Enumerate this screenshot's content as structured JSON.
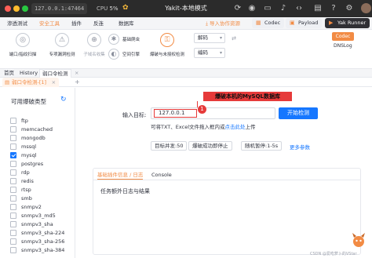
{
  "titlebar": {
    "ip": "127.0.0.1:47464",
    "cpu_label": "CPU",
    "cpu_value": "5%",
    "title": "Yakit-本地模式"
  },
  "menu": {
    "items": [
      "渗透测试",
      "安全工具",
      "插件",
      "反连",
      "数据库"
    ],
    "active": "安全工具",
    "import_label": "导入协作资源",
    "codec_btn": "Codec",
    "payload_btn": "Payload",
    "yakrunner_btn": "Yak Runner"
  },
  "toolbar": {
    "tools": [
      {
        "label": "端口/指纹扫描",
        "state": "normal",
        "icon": "port-scan-icon"
      },
      {
        "label": "专项漏洞检测",
        "state": "normal",
        "icon": "vuln-scan-icon"
      },
      {
        "label": "子域名收集",
        "state": "faded",
        "icon": "subdomain-icon"
      }
    ],
    "tools_h": [
      {
        "label": "基础爬虫",
        "icon": "crawler-icon"
      },
      {
        "label": "空间引擎",
        "icon": "space-engine-icon"
      }
    ],
    "brute_label": "爆破与未授权检测",
    "decode_select": "解码",
    "encode_select": "编码",
    "codec_badge": "Codec",
    "dnslog": "DNSLog"
  },
  "tabs": {
    "level1": [
      "首页",
      "History",
      "弱口令检测"
    ],
    "level1_active": "弱口令检测",
    "level2": "弱口令检测-[1]"
  },
  "sidebar": {
    "title": "可用爆破类型",
    "items": [
      {
        "label": "ftp",
        "checked": false
      },
      {
        "label": "memcached",
        "checked": false
      },
      {
        "label": "mongodb",
        "checked": false
      },
      {
        "label": "mssql",
        "checked": false
      },
      {
        "label": "mysql",
        "checked": true
      },
      {
        "label": "postgres",
        "checked": false
      },
      {
        "label": "rdp",
        "checked": false
      },
      {
        "label": "redis",
        "checked": false
      },
      {
        "label": "rtsp",
        "checked": false
      },
      {
        "label": "smb",
        "checked": false
      },
      {
        "label": "snmpv2",
        "checked": false
      },
      {
        "label": "snmpv3_md5",
        "checked": false
      },
      {
        "label": "snmpv3_sha",
        "checked": false
      },
      {
        "label": "snmpv3_sha-224",
        "checked": false
      },
      {
        "label": "snmpv3_sha-256",
        "checked": false
      },
      {
        "label": "snmpv3_sha-384",
        "checked": false
      }
    ]
  },
  "main": {
    "annotation": "爆破本机的MySQL数据库",
    "annotation_number": "1",
    "target_label": "输入目标:",
    "target_value": "127.0.0.1",
    "start_button": "开始检测",
    "hint_prefix": "可将TXT、Excel文件拖入框内或",
    "hint_link": "点击此处",
    "hint_suffix": "上传",
    "options": [
      "目标并发:50",
      "爆破成功即停止",
      "随机暂停:1-5s"
    ],
    "more_params": "更多参数",
    "panel_tabs": [
      "基础插件信息 / 日志",
      "Console"
    ],
    "panel_active": "基础插件信息 / 日志",
    "panel_title": "任务额外日志与结果"
  },
  "watermark": "CSDN @爱吃萝卜的VStar",
  "colors": {
    "accent": "#f28b44",
    "primary": "#1677ff",
    "annotation": "#e63a3a"
  }
}
